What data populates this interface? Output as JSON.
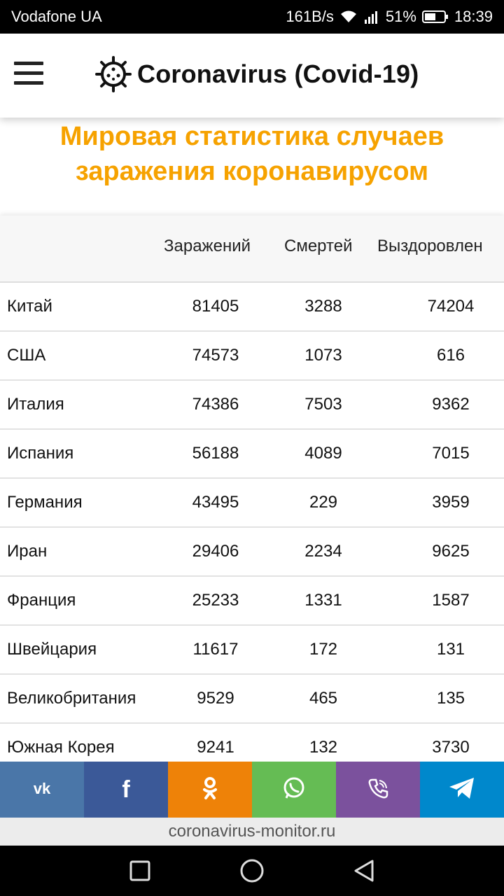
{
  "status": {
    "carrier": "Vodafone UA",
    "speed": "161B/s",
    "battery": "51%",
    "time": "18:39"
  },
  "header": {
    "title": "Coronavirus (Covid-19)"
  },
  "page": {
    "title_line1": "Мировая статистика случаев",
    "title_line2": "заражения коронавирусом"
  },
  "table": {
    "columns": [
      "",
      "Заражений",
      "Смертей",
      "Выздоровлен"
    ],
    "rows": [
      [
        "Китай",
        "81405",
        "3288",
        "74204"
      ],
      [
        "США",
        "74573",
        "1073",
        "616"
      ],
      [
        "Италия",
        "74386",
        "7503",
        "9362"
      ],
      [
        "Испания",
        "56188",
        "4089",
        "7015"
      ],
      [
        "Германия",
        "43495",
        "229",
        "3959"
      ],
      [
        "Иран",
        "29406",
        "2234",
        "9625"
      ],
      [
        "Франция",
        "25233",
        "1331",
        "1587"
      ],
      [
        "Швейцария",
        "11617",
        "172",
        "131"
      ],
      [
        "Великобритания",
        "9529",
        "465",
        "135"
      ],
      [
        "Южная Корея",
        "9241",
        "132",
        "3730"
      ]
    ]
  },
  "share": [
    {
      "name": "vk",
      "label": "vk",
      "color": "#4a76a8"
    },
    {
      "name": "facebook",
      "label": "f",
      "color": "#3b5998"
    },
    {
      "name": "odnoklassniki",
      "label": "ok",
      "color": "#ee8208"
    },
    {
      "name": "whatsapp",
      "label": "wa",
      "color": "#65bc54"
    },
    {
      "name": "viber",
      "label": "viber",
      "color": "#7b519d"
    },
    {
      "name": "telegram",
      "label": "tg",
      "color": "#0088cc"
    }
  ],
  "footer": {
    "site": "coronavirus-monitor.ru"
  }
}
